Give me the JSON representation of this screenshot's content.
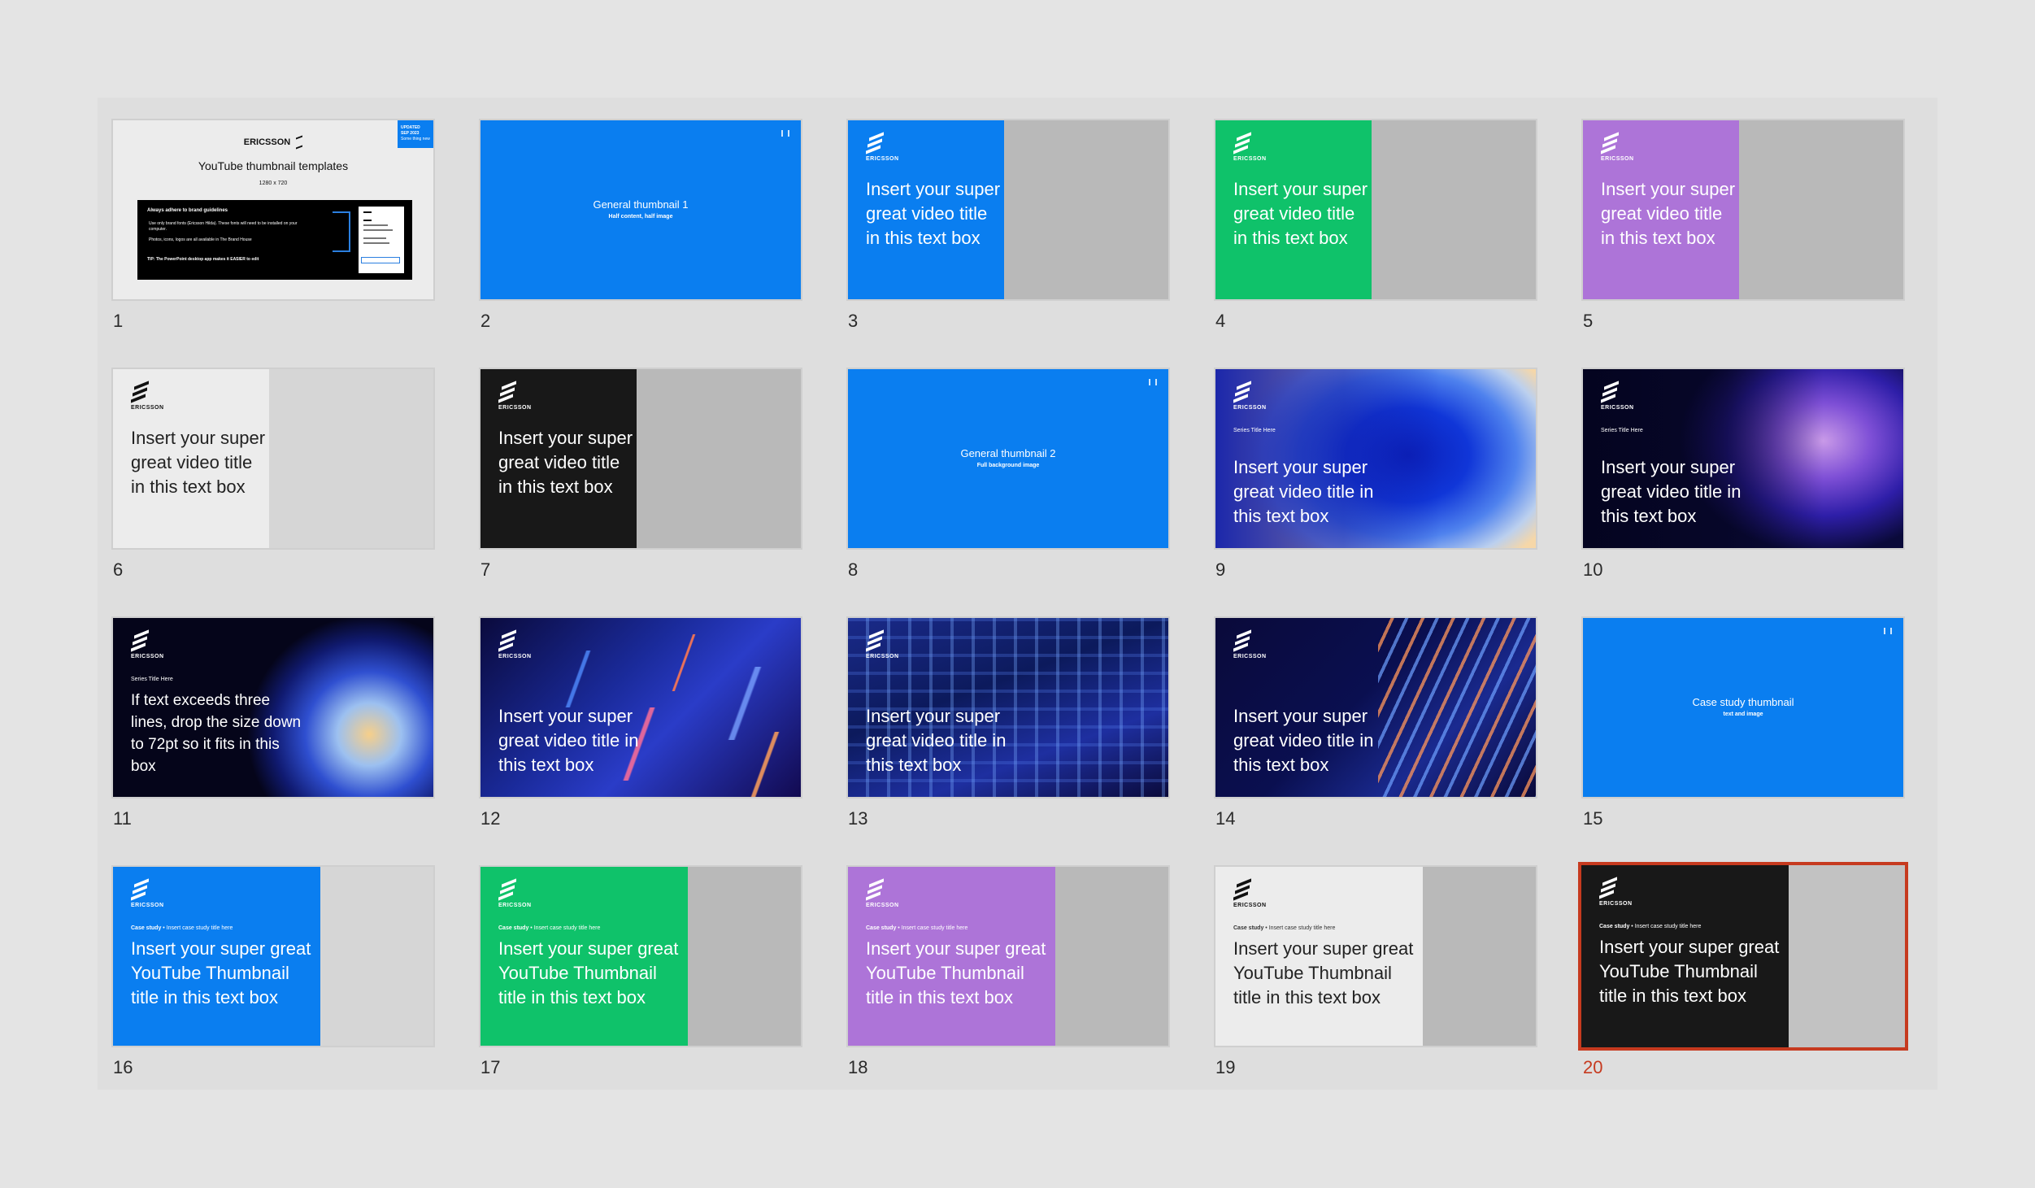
{
  "brand": {
    "logo_text": "ERICSSON"
  },
  "slides": [
    {
      "number": "1",
      "cover": {
        "brand": "ERICSSON",
        "title": "YouTube thumbnail templates",
        "size": "1280 x 720",
        "box_heading": "Always adhere to brand guidelines",
        "bullets": [
          "Use only brand fonts (Ericsson Hilda). These fonts will need to be installed on your computer.",
          "Photos, icons, logos are all available in The Brand House"
        ],
        "tip": "TIP: The PowerPoint desktop app makes it EASIER to edit",
        "badge": [
          "UPDATED",
          "SEP 2023",
          "Some thing new"
        ]
      }
    },
    {
      "number": "2",
      "center_title": "General thumbnail 1",
      "center_sub": "Half content, half image"
    },
    {
      "number": "3",
      "title": "Insert your super great video title in this text box"
    },
    {
      "number": "4",
      "title": "Insert your super great video title in this text box"
    },
    {
      "number": "5",
      "title": "Insert your super great video title in this text box"
    },
    {
      "number": "6",
      "title": "Insert your super great video title in this text box"
    },
    {
      "number": "7",
      "title": "Insert your super great video title in this text box"
    },
    {
      "number": "8",
      "center_title": "General thumbnail 2",
      "center_sub": "Full background image"
    },
    {
      "number": "9",
      "series": "Series Title Here",
      "title": "Insert your super great video title in this text box"
    },
    {
      "number": "10",
      "series": "Series Title Here",
      "title": "Insert your super great video title in this text box"
    },
    {
      "number": "11",
      "series": "Series Title Here",
      "title": "If text exceeds three lines, drop the size down to 72pt so it fits in this box"
    },
    {
      "number": "12",
      "title": "Insert your super great video title in this text box"
    },
    {
      "number": "13",
      "title": "Insert your super great video title in this text box"
    },
    {
      "number": "14",
      "title": "Insert your super great video title in this text box"
    },
    {
      "number": "15",
      "center_title": "Case study thumbnail",
      "center_sub": "text and image"
    },
    {
      "number": "16",
      "case_label": "Case study",
      "case_sub": "Insert case study title here",
      "title": "Insert your super great YouTube Thumbnail title in this text box"
    },
    {
      "number": "17",
      "case_label": "Case study",
      "case_sub": "Insert case study title here",
      "title": "Insert your super great YouTube Thumbnail title in this text box"
    },
    {
      "number": "18",
      "case_label": "Case study",
      "case_sub": "Insert case study title here",
      "title": "Insert your super great YouTube Thumbnail title in this text box"
    },
    {
      "number": "19",
      "case_label": "Case study",
      "case_sub": "Insert case study title here",
      "title": "Insert your super great YouTube Thumbnail title in this text box"
    },
    {
      "number": "20",
      "case_label": "Case study",
      "case_sub": "Insert case study title here",
      "title": "Insert your super great YouTube Thumbnail title in this text box",
      "selected": true
    }
  ],
  "colors": {
    "blue": "#0a7ef0",
    "green": "#0fc26a",
    "purple": "#ad74d8",
    "light": "#ececec",
    "dark": "#181818",
    "grey": "#b9b9b9",
    "selection": "#c63a1f"
  }
}
